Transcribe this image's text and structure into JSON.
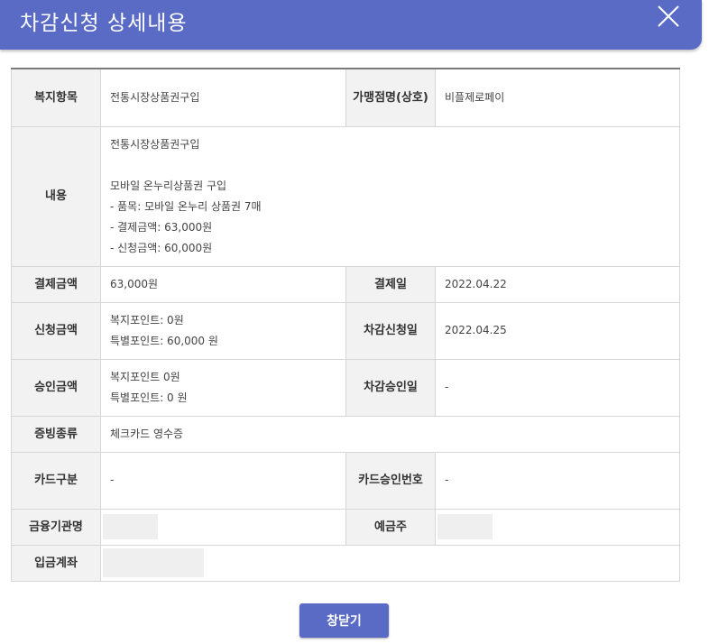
{
  "header": {
    "title": "차감신청 상세내용"
  },
  "labels": {
    "welfare_item": "복지항목",
    "merchant": "가맹점명(상호)",
    "content": "내용",
    "payment_amount": "결제금액",
    "payment_date": "결제일",
    "request_amount": "신청금액",
    "deduction_request_date": "차감신청일",
    "approved_amount": "승인금액",
    "deduction_approval_date": "차감승인일",
    "receipt_type": "증빙종류",
    "card_type": "카드구분",
    "card_approval_no": "카드승인번호",
    "bank_name": "금융기관명",
    "account_holder": "예금주",
    "deposit_account": "입금계좌"
  },
  "values": {
    "welfare_item": "전통시장상품권구입",
    "merchant": "비플제로페이",
    "content": "전통시장상품권구입\n\n모바일 온누리상품권 구입\n- 품목: 모바일 온누리 상품권 7매\n- 결제금액: 63,000원\n- 신청금액: 60,000원",
    "payment_amount": "63,000원",
    "payment_date": "2022.04.22",
    "request_amount": "복지포인트: 0원\n특별포인트: 60,000 원",
    "deduction_request_date": "2022.04.25",
    "approved_amount": "복지포인트 0원\n특별포인트: 0 원",
    "deduction_approval_date": "-",
    "receipt_type": "체크카드 영수증",
    "card_type": "-",
    "card_approval_no": "-"
  },
  "footer": {
    "close_label": "창닫기"
  },
  "colors": {
    "accent": "#5a6bc6",
    "label_bg": "#f2f2f2",
    "border": "#d6d6d6"
  },
  "icons": {
    "close": "close-icon"
  }
}
